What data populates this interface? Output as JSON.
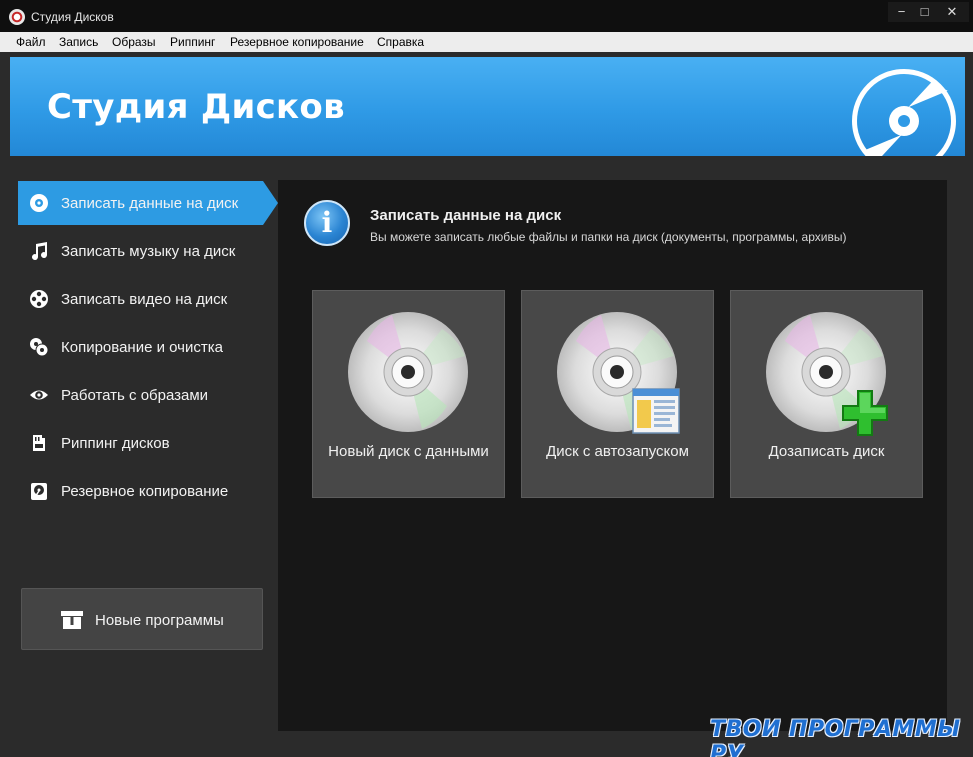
{
  "window": {
    "title": "Студия Дисков",
    "minimize": "−",
    "maximize": "□",
    "close": "✕"
  },
  "menu": [
    "Файл",
    "Запись",
    "Образы",
    "Риппинг",
    "Резервное копирование",
    "Справка"
  ],
  "banner": {
    "title": "Студия Дисков",
    "logo_icon": "disc-logo-icon"
  },
  "sidebar": {
    "active_index": 0,
    "active_color": "#2d9be3",
    "items": [
      {
        "label": "Записать данные на диск",
        "icon": "disc-icon"
      },
      {
        "label": "Записать музыку на диск",
        "icon": "music-note-icon"
      },
      {
        "label": "Записать видео на диск",
        "icon": "film-reel-icon"
      },
      {
        "label": "Копирование и очистка",
        "icon": "copy-discs-icon"
      },
      {
        "label": "Работать с образами",
        "icon": "eye-icon"
      },
      {
        "label": "Риппинг дисков",
        "icon": "sd-card-icon"
      },
      {
        "label": "Резервное копирование",
        "icon": "backup-disk-icon"
      }
    ],
    "new_programs": {
      "label": "Новые программы",
      "icon": "gift-box-icon"
    }
  },
  "content": {
    "icon": "info-icon",
    "title": "Записать данные на диск",
    "description": "Вы можете записать любые файлы и папки на диск (документы, программы, архивы)",
    "options": [
      {
        "label": "Новый диск с данными",
        "icon": "cd-icon",
        "badge": ""
      },
      {
        "label": "Диск с автозапуском",
        "icon": "cd-icon",
        "badge": "autorun-window-icon"
      },
      {
        "label": "Дозаписать диск",
        "icon": "cd-icon",
        "badge": "green-plus-icon"
      }
    ]
  },
  "watermark": "ТВОИ ПРОГРАММЫ РУ"
}
